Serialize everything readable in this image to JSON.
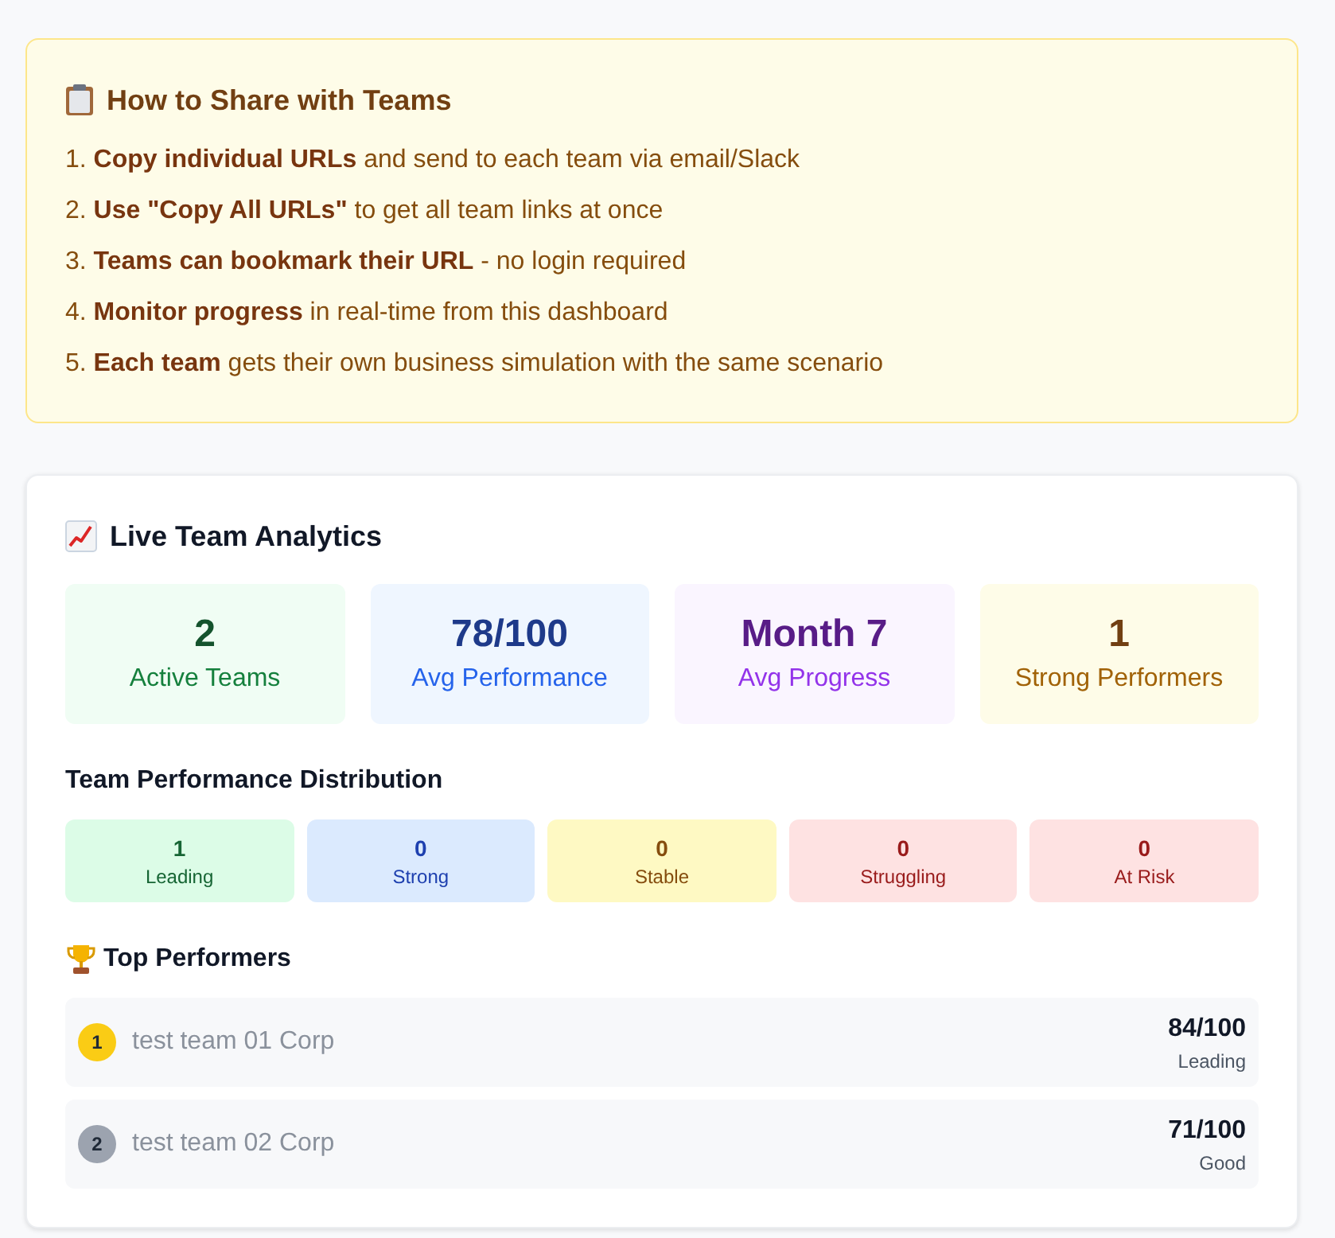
{
  "share_instructions": {
    "title": "How to Share with Teams",
    "steps": [
      "1. **Copy individual URLs** and send to each team via email/Slack",
      "2. **Use \"Copy All URLs\"** to get all team links at once",
      "3. **Teams can bookmark their URL** - no login required",
      "4. **Monitor progress** in real-time from this dashboard",
      "5. **Each team** gets their own business simulation with the same scenario"
    ]
  },
  "analytics": {
    "title": "Live Team Analytics",
    "stats": [
      {
        "value": "2",
        "label": "Active Teams",
        "color": "#f0fdf4"
      },
      {
        "value": "78/100",
        "label": "Avg Performance",
        "color": "#eff6ff"
      },
      {
        "value": "Month 7",
        "label": "Avg Progress",
        "color": "#faf5ff"
      },
      {
        "value": "1",
        "label": "Strong Performers",
        "color": "#fefce8"
      }
    ],
    "distribution": {
      "title": "Team Performance Distribution",
      "buckets": [
        {
          "count": "1",
          "label": "Leading",
          "color": "#dcfce7"
        },
        {
          "count": "0",
          "label": "Strong",
          "color": "#dbeafe"
        },
        {
          "count": "0",
          "label": "Stable",
          "color": "#fef9c3"
        },
        {
          "count": "0",
          "label": "Struggling",
          "color": "#fee2e2"
        },
        {
          "count": "0",
          "label": "At Risk",
          "color": "#fee2e2"
        }
      ]
    },
    "top_performers": {
      "title": "Top Performers",
      "teams": [
        {
          "rank": "1",
          "name": "test team 01 Corp",
          "score": "84/100",
          "rating": "Leading",
          "color": "#facc15"
        },
        {
          "rank": "2",
          "name": "test team 02 Corp",
          "score": "71/100",
          "rating": "Good",
          "color": "#9ca3af"
        }
      ]
    }
  }
}
